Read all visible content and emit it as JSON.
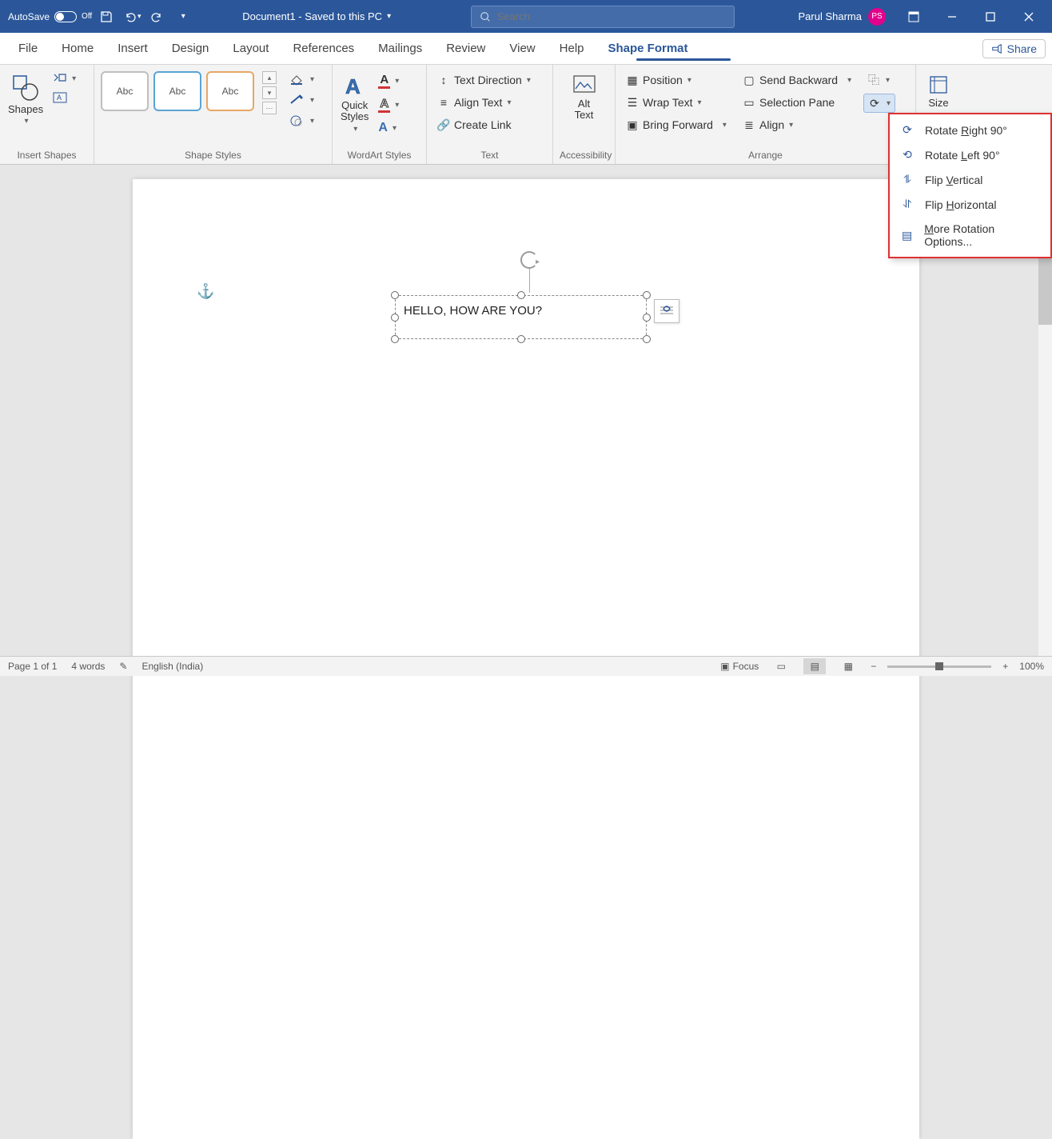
{
  "titlebar": {
    "autosave_label": "AutoSave",
    "autosave_state": "Off",
    "doc_title": "Document1 - Saved to this PC",
    "search_placeholder": "Search",
    "user_name": "Parul Sharma",
    "user_initials": "PS"
  },
  "tabs": {
    "items": [
      "File",
      "Home",
      "Insert",
      "Design",
      "Layout",
      "References",
      "Mailings",
      "Review",
      "View",
      "Help",
      "Shape Format"
    ],
    "share": "Share"
  },
  "ribbon": {
    "insert_shapes": {
      "shapes_btn": "Shapes",
      "label": "Insert Shapes"
    },
    "shape_styles": {
      "thumb_text": "Abc",
      "label": "Shape Styles"
    },
    "wordart": {
      "quick_styles": "Quick\nStyles",
      "label": "WordArt Styles"
    },
    "text": {
      "text_direction": "Text Direction",
      "align_text": "Align Text",
      "create_link": "Create Link",
      "label": "Text"
    },
    "accessibility": {
      "alt_text": "Alt\nText",
      "label": "Accessibility"
    },
    "arrange": {
      "position": "Position",
      "wrap_text": "Wrap Text",
      "bring_forward": "Bring Forward",
      "send_backward": "Send Backward",
      "selection_pane": "Selection Pane",
      "align": "Align",
      "label": "Arrange"
    },
    "size": {
      "label": "Size"
    }
  },
  "dropdown": {
    "rotate_right": "Rotate Right 90°",
    "rotate_left": "Rotate Left 90°",
    "flip_vertical": "Flip Vertical",
    "flip_horizontal": "Flip Horizontal",
    "more_options": "More Rotation Options..."
  },
  "document": {
    "textbox_content": "HELLO, HOW ARE YOU?"
  },
  "status": {
    "page": "Page 1 of 1",
    "words": "4 words",
    "language": "English (India)",
    "focus": "Focus",
    "zoom": "100%"
  }
}
